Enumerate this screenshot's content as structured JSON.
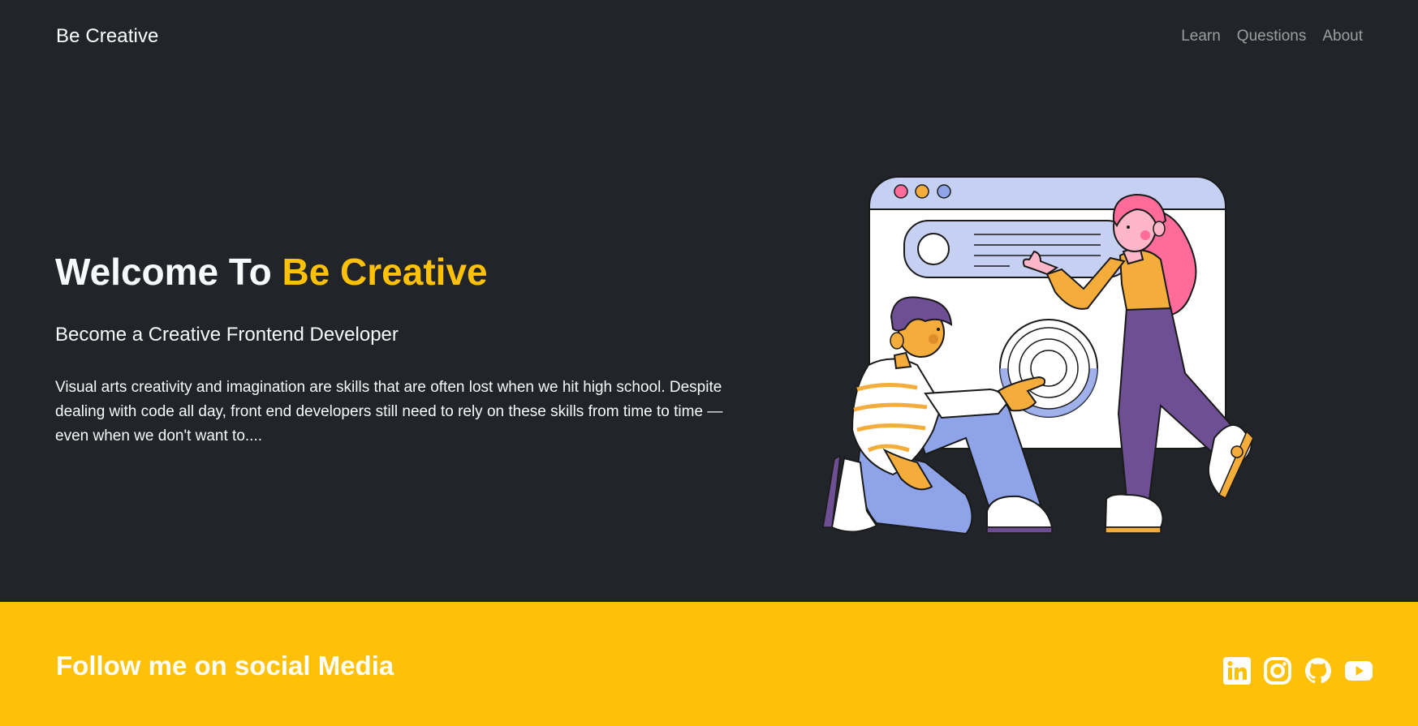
{
  "navbar": {
    "brand": "Be Creative",
    "links": [
      {
        "label": "Learn"
      },
      {
        "label": "Questions"
      },
      {
        "label": "About"
      }
    ]
  },
  "hero": {
    "title_prefix": "Welcome To ",
    "title_accent": "Be Creative",
    "subtitle": "Become a Creative Frontend Developer",
    "body": "Visual arts creativity and imagination are skills that are often lost when we hit high school. Despite dealing with code all day, front end developers still need to rely on these skills from time to time — even when we don't want to...."
  },
  "footer": {
    "title": "Follow me on social Media",
    "social_icons": [
      "linkedin-icon",
      "instagram-icon",
      "github-icon",
      "youtube-icon"
    ]
  },
  "colors": {
    "background": "#212529",
    "accent": "#ffc107",
    "text": "#f8f9fa",
    "nav_link": "rgba(255,255,255,0.55)"
  }
}
